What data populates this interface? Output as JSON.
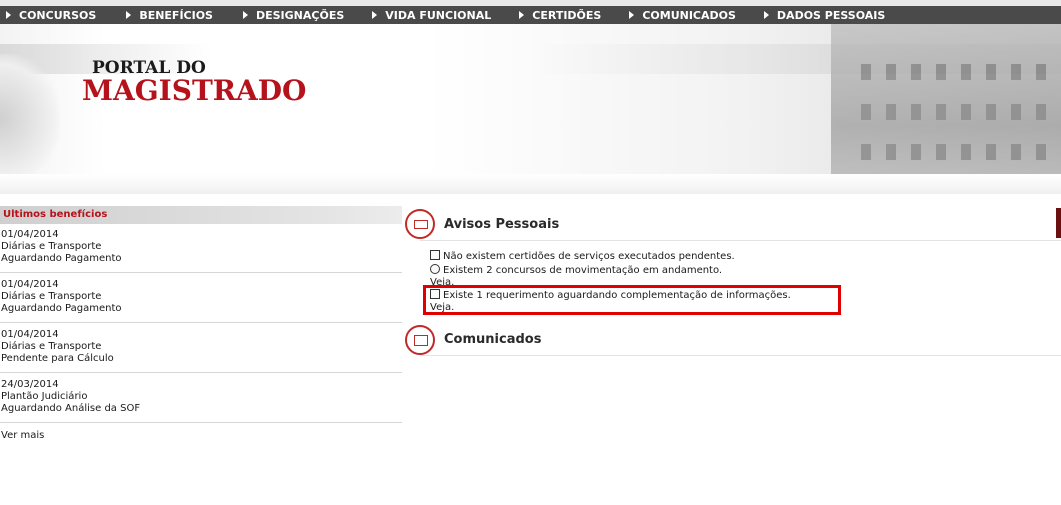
{
  "nav": {
    "items": [
      {
        "label": "CONCURSOS"
      },
      {
        "label": "BENEFÍCIOS"
      },
      {
        "label": "DESIGNAÇÕES"
      },
      {
        "label": "VIDA FUNCIONAL"
      },
      {
        "label": "CERTIDÕES"
      },
      {
        "label": "COMUNICADOS"
      },
      {
        "label": "DADOS PESSOAIS"
      }
    ]
  },
  "brand": {
    "line1": "PORTAL DO",
    "line2": "MAGISTRADO",
    "accent_color": "#b5121b"
  },
  "benefits": {
    "title": "Ultimos benefícios",
    "entries": [
      {
        "date": "01/04/2014",
        "type": "Diárias e Transporte",
        "status": "Aguardando Pagamento"
      },
      {
        "date": "01/04/2014",
        "type": "Diárias e Transporte",
        "status": "Aguardando Pagamento"
      },
      {
        "date": "01/04/2014",
        "type": "Diárias e Transporte",
        "status": "Pendente para Cálculo"
      },
      {
        "date": "24/03/2014",
        "type": "Plantão Judiciário",
        "status": "Aguardando Análise da SOF"
      }
    ],
    "more_label": "Ver mais"
  },
  "avisos": {
    "title": "Avisos Pessoais",
    "notices": [
      {
        "icon": "certificate-icon",
        "text": "Não existem certidões de serviços executados pendentes."
      },
      {
        "icon": "people-icon",
        "text": "Existem 2 concursos de movimentação em andamento.",
        "link": "Veja."
      },
      {
        "icon": "clipboard-icon",
        "text": "Existe 1 requerimento aguardando complementação de informações.",
        "link": "Veja."
      }
    ],
    "highlight_color": "#e00000"
  },
  "comunicados": {
    "title": "Comunicados"
  }
}
